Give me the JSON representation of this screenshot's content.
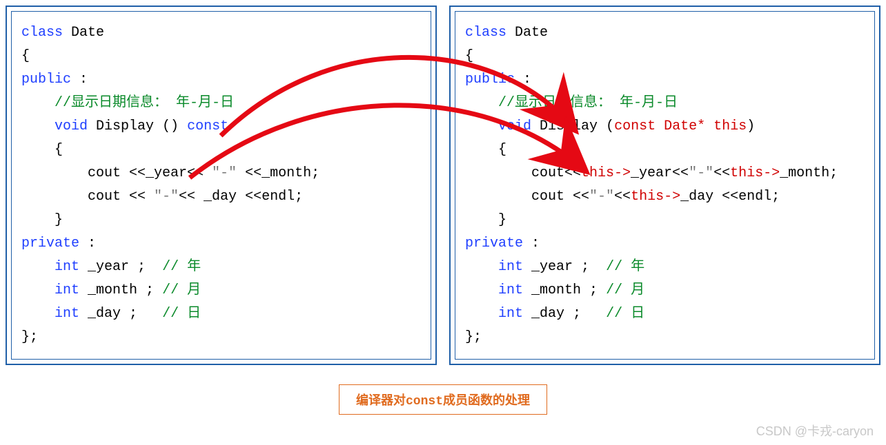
{
  "left": {
    "l1a": "class",
    "l1b": " Date",
    "l2": "{",
    "l3": "public",
    "l3b": " :",
    "l4": "    //显示日期信息： 年-月-日",
    "l5a": "    ",
    "l5b": "void",
    "l5c": " Display () ",
    "l5d": "const",
    "l6": "    {",
    "l7a": "        cout <<_year<< ",
    "l7b": "\"-\"",
    "l7c": " <<_month;",
    "l8a": "        cout << ",
    "l8b": "\"-\"",
    "l8c": "<< _day <<endl;",
    "l9": "    }",
    "l10": "private",
    "l10b": " :",
    "l11a": "    ",
    "l11b": "int",
    "l11c": " _year ;  ",
    "l11d": "// 年",
    "l12a": "    ",
    "l12b": "int",
    "l12c": " _month ; ",
    "l12d": "// 月",
    "l13a": "    ",
    "l13b": "int",
    "l13c": " _day ;   ",
    "l13d": "// 日",
    "l14": "};"
  },
  "right": {
    "l1a": "class",
    "l1b": " Date",
    "l2": "{",
    "l3": "public",
    "l3b": " :",
    "l4": "    //显示日期信息： 年-月-日",
    "l5a": "    ",
    "l5b": "void",
    "l5c": " Display (",
    "l5d": "const Date* this",
    "l5e": ")",
    "l6": "    {",
    "l7a": "        cout<<",
    "l7b": "this->",
    "l7c": "_year<<",
    "l7d": "\"-\"",
    "l7e": "<<",
    "l7f": "this->",
    "l7g": "_month;",
    "l8a": "        cout <<",
    "l8b": "\"-\"",
    "l8c": "<<",
    "l8d": "this->",
    "l8e": "_day <<endl;",
    "l9": "    }",
    "l10": "private",
    "l10b": " :",
    "l11a": "    ",
    "l11b": "int",
    "l11c": " _year ;  ",
    "l11d": "// 年",
    "l12a": "    ",
    "l12b": "int",
    "l12c": " _month ; ",
    "l12d": "// 月",
    "l13a": "    ",
    "l13b": "int",
    "l13c": " _day ;   ",
    "l13d": "// 日",
    "l14": "};"
  },
  "caption": "编译器对const成员函数的处理",
  "watermark": "CSDN @卡戎-caryon"
}
